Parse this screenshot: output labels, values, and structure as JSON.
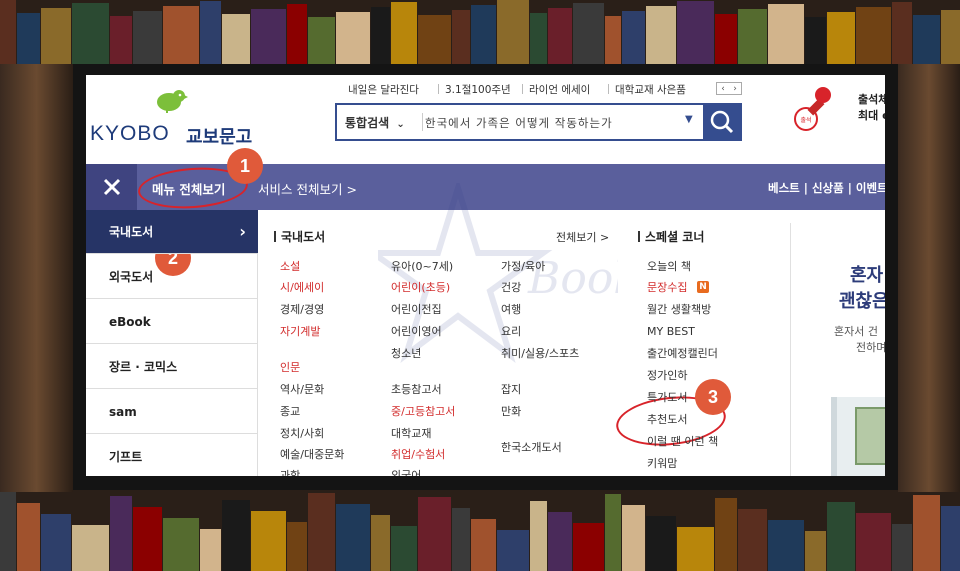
{
  "logo": {
    "latin": "KYOBO",
    "korean": "교보문고"
  },
  "top_links": [
    "내일은 달라진다",
    "3.1절100주년",
    "라이언 에세이",
    "대학교재 사은품"
  ],
  "search": {
    "category": "통합검색",
    "query": "한국에서 가족은 어떻게 작동하는가"
  },
  "right_cut": [
    "출석체",
    "최대 e"
  ],
  "nav": {
    "menu_all": "메뉴 전체보기",
    "service_all": "서비스 전체보기 >",
    "right_links": "베스트 | 신상품 | 이벤트"
  },
  "sidebar": [
    "국내도서",
    "외국도서",
    "eBook",
    "장르 · 코믹스",
    "sam",
    "기프트"
  ],
  "domestic": {
    "heading": "국내도서",
    "view_all": "전체보기 >",
    "col1": [
      "소설",
      "시/에세이",
      "경제/경영",
      "자기계발",
      "인문",
      "역사/문화",
      "종교",
      "정치/사회",
      "예술/대중문화",
      "과학"
    ],
    "col2": [
      "유아(0~7세)",
      "어린이(초등)",
      "어린이전집",
      "어린이영어",
      "청소년",
      "초등참고서",
      "중/고등참고서",
      "대학교재",
      "취업/수험서",
      "외국어"
    ],
    "col3": [
      "가정/육아",
      "건강",
      "여행",
      "요리",
      "취미/실용/스포츠",
      "잡지",
      "만화",
      "한국소개도서"
    ]
  },
  "special": {
    "heading": "스페셜 코너",
    "items": [
      "오늘의 책",
      "문장수집",
      "월간 생활책방",
      "MY BEST",
      "출간예정캘린더",
      "정가인하",
      "특가도서",
      "추천도서",
      "이럴 땐 이런 책",
      "키워맘"
    ],
    "new_badge": "N"
  },
  "promo": {
    "line1": "혼자",
    "line2": "괜찮은",
    "sub1": "혼자서 건",
    "sub2": "전하며"
  },
  "watermark": "Book",
  "callouts": [
    "1",
    "2",
    "3"
  ],
  "colors": {
    "nav_bg": "#5a5f9c",
    "sidebar_active": "#263466",
    "accent_red": "#d22c2c",
    "callout": "#e05a3a",
    "ring": "#d8232a",
    "search_btn": "#354d8f"
  }
}
